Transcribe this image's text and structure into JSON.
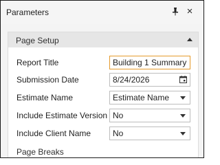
{
  "window": {
    "title": "Parameters",
    "pin_icon": "pin-icon",
    "close_glyph": "×"
  },
  "section": {
    "title": "Page Setup",
    "collapse_icon": "chevron-up-icon",
    "fields": {
      "report_title": {
        "label": "Report Title",
        "value": "Building 1 Summary"
      },
      "submission_date": {
        "label": "Submission Date",
        "value": "8/24/2026",
        "icon": "calendar-icon"
      },
      "estimate_name": {
        "label": "Estimate Name",
        "value": "Estimate Name"
      },
      "include_estimate_version": {
        "label": "Include Estimate Version",
        "value": "No"
      },
      "include_client_name": {
        "label": "Include Client Name",
        "value": "No"
      }
    },
    "subheader": "Page Breaks"
  },
  "colors": {
    "focus_border": "#e59a2b",
    "section_header_bg": "#e6e6e6",
    "panel_bg": "#f4f4f4"
  }
}
